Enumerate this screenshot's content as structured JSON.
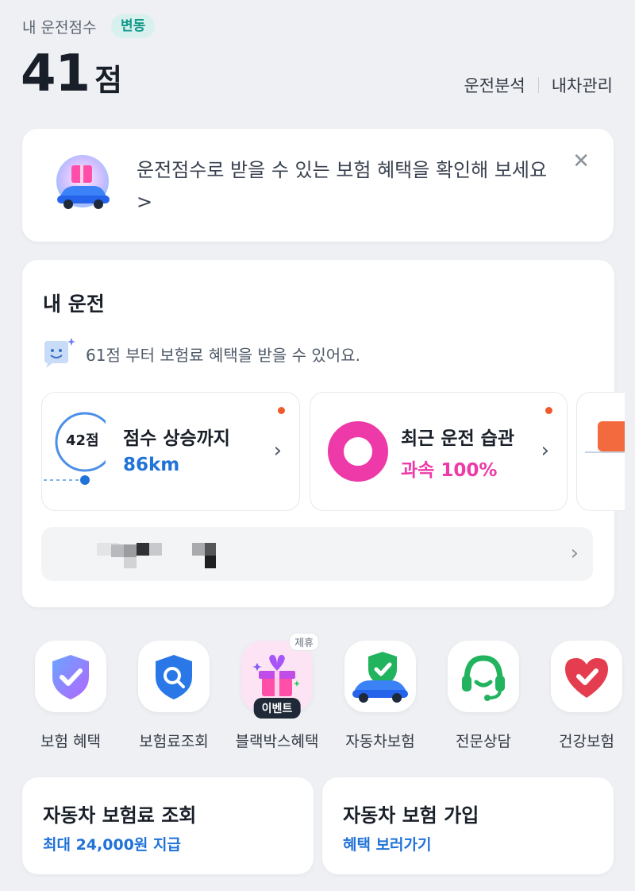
{
  "header": {
    "label": "내 운전점수",
    "badge": "변동",
    "score_value": "41",
    "score_unit": "점",
    "links": [
      "운전분석",
      "내차관리"
    ]
  },
  "promo": {
    "text": "운전점수로 받을 수 있는 보험 혜택을 확인해 보세요 >",
    "close_icon": "close-icon"
  },
  "my_driving": {
    "title": "내 운전",
    "info": "61점 부터 보험료 혜택을 받을 수 있어요.",
    "cards": [
      {
        "badge": "42점",
        "title": "점수 상승까지",
        "value": "86km",
        "accent": "#2173d8"
      },
      {
        "title": "최근 운전 습관",
        "value": "과속 100%",
        "accent": "#ee3aa8"
      }
    ]
  },
  "quick_menu": [
    {
      "label": "보험 혜택",
      "icon": "shield-check-icon"
    },
    {
      "label": "보험료조회",
      "icon": "shield-search-icon"
    },
    {
      "label": "블랙박스혜택",
      "icon": "gift-icon",
      "tag_top": "제휴",
      "tag_bottom": "이벤트"
    },
    {
      "label": "자동차보험",
      "icon": "car-shield-icon"
    },
    {
      "label": "전문상담",
      "icon": "headset-icon"
    },
    {
      "label": "건강보험",
      "icon": "heart-check-icon"
    }
  ],
  "bottom_cards": [
    {
      "title": "자동차 보험료 조회",
      "sub": "최대 24,000원 지급"
    },
    {
      "title": "자동차 보험 가입",
      "sub": "혜택 보러가기"
    }
  ],
  "colors": {
    "accent_blue": "#2173d8",
    "accent_pink": "#ee3aa8",
    "badge_teal": "#12988a",
    "alert_dot": "#ef5a2a"
  }
}
